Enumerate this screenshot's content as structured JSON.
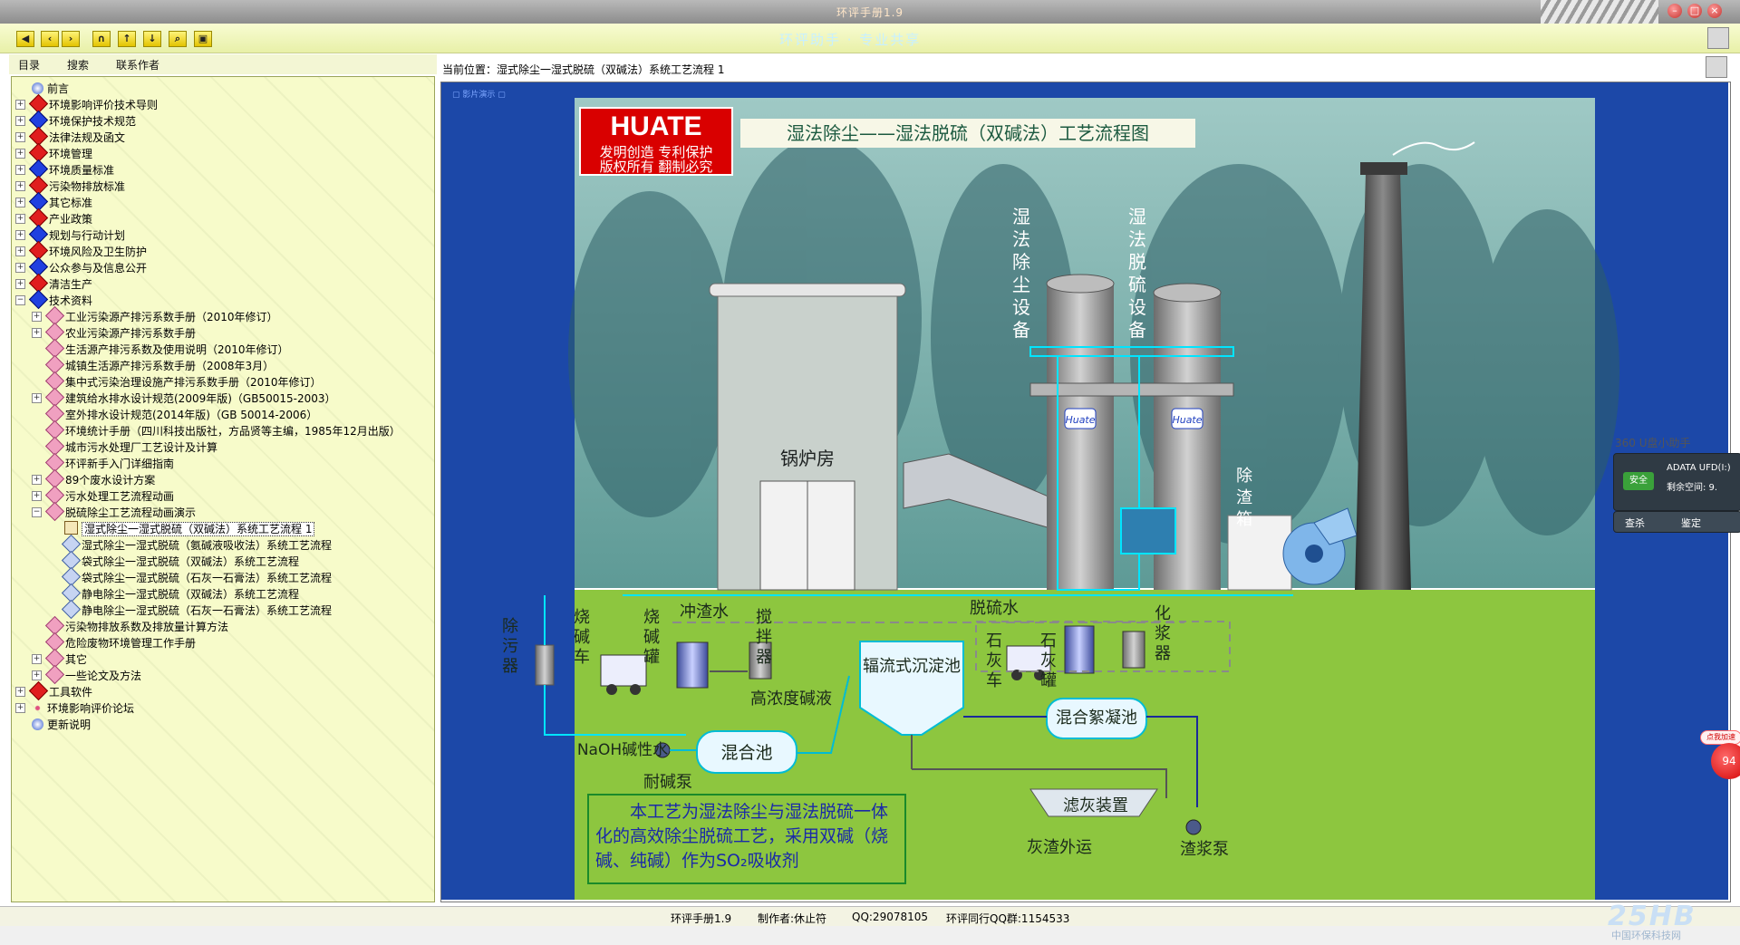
{
  "app": {
    "title": "环评手册1.9"
  },
  "toolbar": {
    "slogan": "环评助手 · 专业共享",
    "buttons": [
      "◀",
      "<",
      ">",
      "⌂",
      "↑",
      "↓",
      "🔍",
      "🖨"
    ]
  },
  "left_tabs": {
    "tab_contents": "目录",
    "tab_search": "搜索",
    "tab_contact": "联系作者"
  },
  "tree": [
    {
      "label": "前言",
      "level": 0,
      "icon": "orb",
      "expand": ""
    },
    {
      "label": "环境影响评价技术导则",
      "level": 0,
      "icon": "red",
      "expand": "+"
    },
    {
      "label": "环境保护技术规范",
      "level": 0,
      "icon": "blue",
      "expand": "+"
    },
    {
      "label": "法律法规及函文",
      "level": 0,
      "icon": "red",
      "expand": "+"
    },
    {
      "label": "环境管理",
      "level": 0,
      "icon": "red",
      "expand": "+"
    },
    {
      "label": "环境质量标准",
      "level": 0,
      "icon": "blue",
      "expand": "+"
    },
    {
      "label": "污染物排放标准",
      "level": 0,
      "icon": "red",
      "expand": "+"
    },
    {
      "label": "其它标准",
      "level": 0,
      "icon": "blue",
      "expand": "+"
    },
    {
      "label": "产业政策",
      "level": 0,
      "icon": "red",
      "expand": "+"
    },
    {
      "label": "规划与行动计划",
      "level": 0,
      "icon": "blue",
      "expand": "+"
    },
    {
      "label": "环境风险及卫生防护",
      "level": 0,
      "icon": "red",
      "expand": "+"
    },
    {
      "label": "公众参与及信息公开",
      "level": 0,
      "icon": "blue",
      "expand": "+"
    },
    {
      "label": "清洁生产",
      "level": 0,
      "icon": "red",
      "expand": "+"
    },
    {
      "label": "技术资料",
      "level": 0,
      "icon": "blue",
      "expand": "−"
    },
    {
      "label": "工业污染源产排污系数手册（2010年修订）",
      "level": 1,
      "icon": "pink",
      "expand": "+"
    },
    {
      "label": "农业污染源产排污系数手册",
      "level": 1,
      "icon": "pink",
      "expand": "+"
    },
    {
      "label": "生活源产排污系数及使用说明（2010年修订）",
      "level": 1,
      "icon": "pink",
      "expand": ""
    },
    {
      "label": "城镇生活源产排污系数手册（2008年3月）",
      "level": 1,
      "icon": "pink",
      "expand": ""
    },
    {
      "label": "集中式污染治理设施产排污系数手册（2010年修订）",
      "level": 1,
      "icon": "pink",
      "expand": ""
    },
    {
      "label": "建筑给水排水设计规范(2009年版)（GB50015-2003）",
      "level": 1,
      "icon": "pink",
      "expand": "+"
    },
    {
      "label": "室外排水设计规范(2014年版)（GB 50014-2006）",
      "level": 1,
      "icon": "pink",
      "expand": ""
    },
    {
      "label": "环境统计手册（四川科技出版社，方品贤等主编，1985年12月出版）",
      "level": 1,
      "icon": "pink",
      "expand": ""
    },
    {
      "label": "城市污水处理厂工艺设计及计算",
      "level": 1,
      "icon": "pink",
      "expand": ""
    },
    {
      "label": "环评新手入门详细指南",
      "level": 1,
      "icon": "pink",
      "expand": ""
    },
    {
      "label": "89个废水设计方案",
      "level": 1,
      "icon": "pink",
      "expand": "+"
    },
    {
      "label": "污水处理工艺流程动画",
      "level": 1,
      "icon": "pink",
      "expand": "+"
    },
    {
      "label": "脱硫除尘工艺流程动画演示",
      "level": 1,
      "icon": "pink",
      "expand": "−"
    },
    {
      "label": "湿式除尘一湿式脱硫（双碱法）系统工艺流程 1",
      "level": 2,
      "icon": "book",
      "expand": "",
      "selected": true
    },
    {
      "label": "湿式除尘一湿式脱硫（氨碱液吸收法）系统工艺流程",
      "level": 2,
      "icon": "doc",
      "expand": ""
    },
    {
      "label": "袋式除尘一湿式脱硫（双碱法）系统工艺流程",
      "level": 2,
      "icon": "doc",
      "expand": ""
    },
    {
      "label": "袋式除尘一湿式脱硫（石灰一石膏法）系统工艺流程",
      "level": 2,
      "icon": "doc",
      "expand": ""
    },
    {
      "label": "静电除尘一湿式脱硫（双碱法）系统工艺流程",
      "level": 2,
      "icon": "doc",
      "expand": ""
    },
    {
      "label": "静电除尘一湿式脱硫（石灰一石膏法）系统工艺流程",
      "level": 2,
      "icon": "doc",
      "expand": ""
    },
    {
      "label": "污染物排放系数及排放量计算方法",
      "level": 1,
      "icon": "pink",
      "expand": ""
    },
    {
      "label": "危险废物环境管理工作手册",
      "level": 1,
      "icon": "pink",
      "expand": ""
    },
    {
      "label": "其它",
      "level": 1,
      "icon": "pink",
      "expand": "+"
    },
    {
      "label": "一些论文及方法",
      "level": 1,
      "icon": "pink",
      "expand": "+"
    },
    {
      "label": "工具软件",
      "level": 0,
      "icon": "red",
      "expand": "+"
    },
    {
      "label": "环境影响评价论坛",
      "level": 0,
      "icon": "dots",
      "expand": "+"
    },
    {
      "label": "更新说明",
      "level": 0,
      "icon": "orb",
      "expand": ""
    }
  ],
  "breadcrumb": "当前位置：湿式除尘一湿式脱硫（双碱法）系统工艺流程 1",
  "diagram": {
    "logo_en": "HUATE",
    "logo_line1": "发明创造  专利保护",
    "logo_line2": "版权所有  翻制必究",
    "title": "湿法除尘——湿法脱硫（双碱法）工艺流程图",
    "boiler": "锅炉房",
    "tower1_label": "湿法除尘设备",
    "tower2_label": "湿法脱硫设备",
    "slag_box": "除渣箱",
    "flush_water": "冲渣水",
    "desulf_water": "脱硫水",
    "decontaminator": "除污器",
    "caustic_truck": "烧碱车",
    "caustic_tank": "烧碱罐",
    "stirrer": "搅拌器",
    "high_conc": "高浓度碱液",
    "radial_tank": "辐流式沉淀池",
    "lime_truck": "石灰车",
    "lime_tank": "石灰罐",
    "slurry_maker": "化浆器",
    "coag_tank": "混合絮凝池",
    "naoh": "NaOH碱性水",
    "mix_tank": "混合池",
    "alkali_pump": "耐碱泵",
    "filter": "滤灰装置",
    "ash_out": "灰渣外运",
    "slurry_pump": "渣浆泵",
    "note": "本工艺为湿法除尘与湿法脱硫一体化的高效除尘脱硫工艺，采用双碱（烧碱、纯碱）作为SO₂吸收剂",
    "brand_plate": "Huate"
  },
  "status": {
    "app": "环评手册1.9",
    "author": "制作者:休止符",
    "qq": "QQ:29078105",
    "group": "环评同行QQ群:1154533"
  },
  "assistant": {
    "title": "360 U盘小助手",
    "tag": "安全",
    "device": "ADATA UFD(I:)",
    "space": "剩余空间: 9.",
    "scan": "查杀",
    "identify": "鉴定"
  },
  "float_ball": {
    "tip": "点我加速",
    "value": "94"
  },
  "watermark": {
    "big": "25HB",
    "small": "中国环保科技网"
  }
}
